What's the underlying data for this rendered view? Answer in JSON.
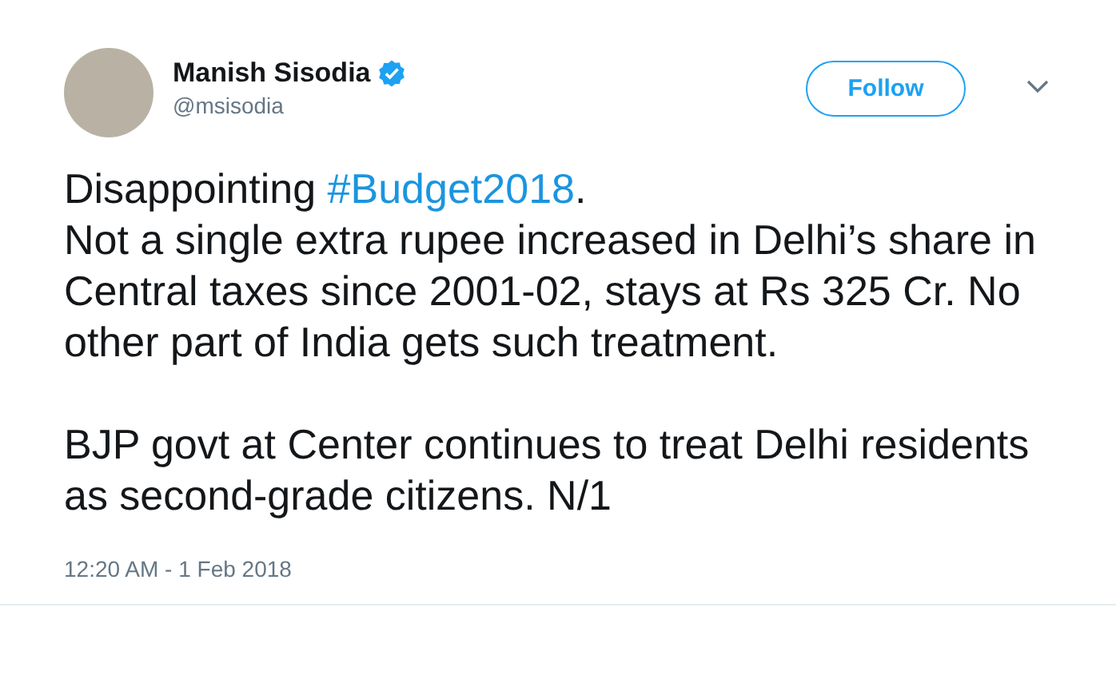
{
  "author": {
    "name": "Manish Sisodia",
    "handle": "@msisodia",
    "verified": true
  },
  "follow_button": "Follow",
  "paragraphs": [
    {
      "parts": [
        {
          "kind": "text",
          "text": "Disappointing "
        },
        {
          "kind": "hashtag",
          "text": "#Budget2018"
        },
        {
          "kind": "text",
          "text": "."
        }
      ]
    },
    {
      "parts": [
        {
          "kind": "text",
          "text": "Not a single extra rupee increased in Delhi’s share in Central taxes since 2001-02, stays at Rs 325 Cr. No other part of India gets such treatment."
        }
      ]
    },
    {
      "parts": [
        {
          "kind": "text",
          "text": "BJP govt at Center continues to treat Delhi residents as second-grade citizens. N/1"
        }
      ]
    }
  ],
  "timestamp": "12:20 AM - 1 Feb 2018"
}
